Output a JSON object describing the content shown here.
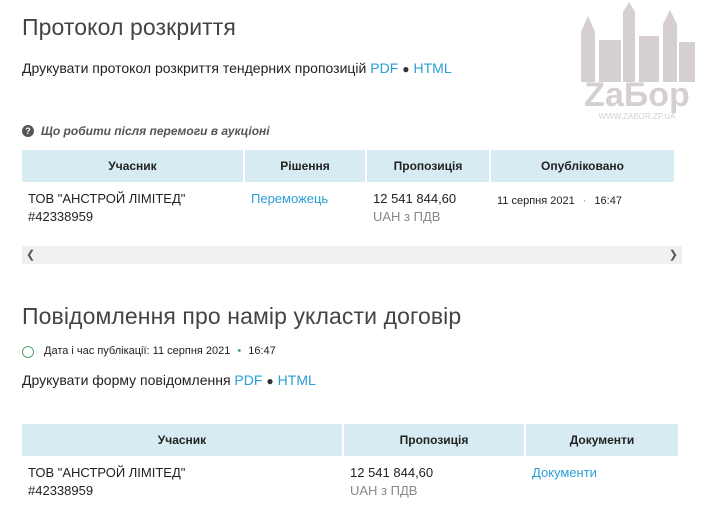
{
  "protocol": {
    "title": "Протокол розкриття",
    "print_text": "Друкувати протокол розкриття тендерних пропозицій",
    "pdf_label": "PDF",
    "html_label": "HTML",
    "hint": "Що робити після перемоги в аукціоні",
    "table": {
      "headers": [
        "Учасник",
        "Рішення",
        "Пропозиція",
        "Опубліковано"
      ],
      "row": {
        "participant": "ТОВ \"АНСТРОЙ ЛІМІТЕД\"",
        "participant_id": "#42338959",
        "decision": "Переможець",
        "amount": "12 541 844,60",
        "currency": "UAH з ПДВ",
        "date": "11 серпня 2021",
        "time": "16:47"
      }
    }
  },
  "notice": {
    "title": "Повідомлення про намір укласти договір",
    "pub_label": "Дата і час публікації: 11 серпня 2021",
    "pub_time": "16:47",
    "print_text": "Друкувати форму повідомлення",
    "pdf_label": "PDF",
    "html_label": "HTML",
    "table": {
      "headers": [
        "Учасник",
        "Пропозиція",
        "Документи"
      ],
      "row": {
        "participant": "ТОВ \"АНСТРОЙ ЛІМІТЕД\"",
        "participant_id": "#42338959",
        "amount": "12 541 844,60",
        "currency": "UAH з ПДВ",
        "docs": "Документи"
      }
    }
  },
  "watermark": {
    "text": "ZaБор",
    "url": "WWW.ZABOR.ZP.UA"
  }
}
